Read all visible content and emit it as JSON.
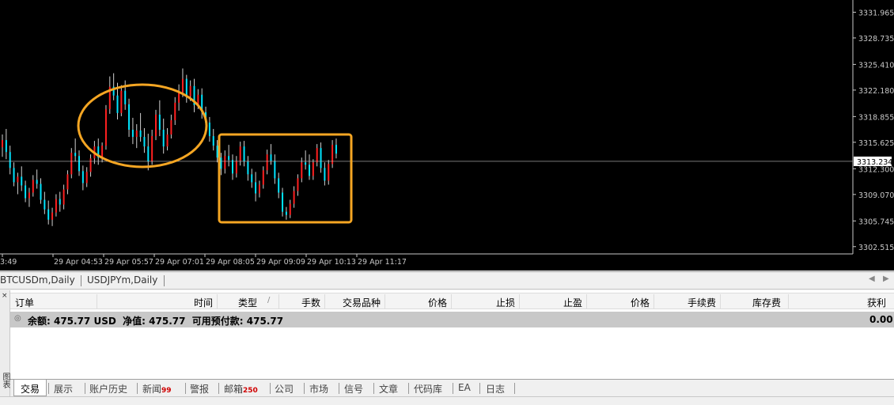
{
  "chart": {
    "background": "#000000",
    "bull_color": "#ff2020",
    "bear_color": "#00e5ff",
    "wick_color": "#d0d0d0",
    "annotation_color": "#f5a623",
    "bid_line_color": "#c0c0c0",
    "price_axis_labels": [
      "3331.965",
      "3328.735",
      "3325.410",
      "3322.180",
      "3318.855",
      "3315.625",
      "3312.300",
      "3309.070",
      "3305.745",
      "3302.515"
    ],
    "current_price": "3313.234",
    "time_axis_labels": [
      "3:49",
      "29 Apr 04:53",
      "29 Apr 05:57",
      "29 Apr 07:01",
      "29 Apr 08:05",
      "29 Apr 09:09",
      "29 Apr 10:13",
      "29 Apr 11:17"
    ]
  },
  "chart_data": {
    "type": "candlestick",
    "ylim": [
      3301.6,
      3333.5
    ],
    "annotations": [
      {
        "shape": "ellipse",
        "label": ""
      },
      {
        "shape": "rectangle",
        "label": ""
      }
    ],
    "candles": [
      [
        3315,
        3316.6,
        3313.8,
        3315.9
      ],
      [
        3315.9,
        3317.3,
        3313.5,
        3314.4
      ],
      [
        3314.4,
        3315.2,
        3311.6,
        3312.4
      ],
      [
        3312.4,
        3313.1,
        3310.1,
        3310.6
      ],
      [
        3310.6,
        3311.8,
        3309.1,
        3311.3
      ],
      [
        3311.3,
        3312.6,
        3309.5,
        3310.2
      ],
      [
        3310.2,
        3310.8,
        3308.1,
        3308.6
      ],
      [
        3308.6,
        3309.9,
        3307.5,
        3309.3
      ],
      [
        3309.3,
        3311.5,
        3308.8,
        3310.9
      ],
      [
        3310.9,
        3312.2,
        3309.8,
        3310.4
      ],
      [
        3310.4,
        3311.1,
        3307.9,
        3308.4
      ],
      [
        3308.4,
        3309.4,
        3306.6,
        3307.2
      ],
      [
        3307.2,
        3308.3,
        3305.3,
        3305.9
      ],
      [
        3305.9,
        3307.4,
        3305.1,
        3306.8
      ],
      [
        3306.8,
        3309.1,
        3306.3,
        3308.5
      ],
      [
        3308.5,
        3309.4,
        3306.9,
        3307.8
      ],
      [
        3307.8,
        3310.3,
        3307.2,
        3309.7
      ],
      [
        3309.7,
        3312.1,
        3309.1,
        3311.6
      ],
      [
        3311.6,
        3314.9,
        3311.1,
        3314.3
      ],
      [
        3314.3,
        3316.1,
        3313.2,
        3313.9
      ],
      [
        3313.9,
        3314.6,
        3311.4,
        3312.0
      ],
      [
        3312.0,
        3312.7,
        3309.6,
        3310.5
      ],
      [
        3310.5,
        3312.5,
        3310.0,
        3311.9
      ],
      [
        3311.9,
        3314.1,
        3311.3,
        3313.6
      ],
      [
        3313.6,
        3315.8,
        3312.9,
        3315.1
      ],
      [
        3315.1,
        3316.1,
        3312.8,
        3313.7
      ],
      [
        3313.7,
        3315.6,
        3313.1,
        3315.2
      ],
      [
        3315.2,
        3320.3,
        3314.7,
        3319.8
      ],
      [
        3319.8,
        3323.9,
        3319.2,
        3322.6
      ],
      [
        3322.6,
        3324.3,
        3320.9,
        3321.5
      ],
      [
        3321.5,
        3323.1,
        3318.5,
        3319.3
      ],
      [
        3319.3,
        3322.8,
        3318.9,
        3322.1
      ],
      [
        3322.1,
        3323.4,
        3319.7,
        3320.4
      ],
      [
        3320.4,
        3321.1,
        3316.3,
        3317.2
      ],
      [
        3317.2,
        3318.7,
        3315.4,
        3316.3
      ],
      [
        3316.3,
        3317.9,
        3314.9,
        3317.1
      ],
      [
        3317.1,
        3319.3,
        3315.7,
        3316.3
      ],
      [
        3316.3,
        3317.4,
        3314.3,
        3315.1
      ],
      [
        3315.1,
        3316.7,
        3312.1,
        3313.2
      ],
      [
        3313.2,
        3317.2,
        3312.8,
        3316.4
      ],
      [
        3316.4,
        3319.7,
        3315.9,
        3319.1
      ],
      [
        3319.1,
        3320.9,
        3316.4,
        3317.2
      ],
      [
        3317.2,
        3318.6,
        3314.2,
        3315.1
      ],
      [
        3315.1,
        3317.4,
        3314.6,
        3316.6
      ],
      [
        3316.6,
        3319.1,
        3316.1,
        3318.4
      ],
      [
        3318.4,
        3321.3,
        3317.8,
        3320.6
      ],
      [
        3320.6,
        3322.9,
        3319.6,
        3321.9
      ],
      [
        3321.9,
        3324.9,
        3321.3,
        3323.6
      ],
      [
        3323.6,
        3324.1,
        3320.6,
        3321.4
      ],
      [
        3321.4,
        3323.4,
        3320.8,
        3322.7
      ],
      [
        3322.7,
        3323.6,
        3319.4,
        3320.3
      ],
      [
        3320.3,
        3322.3,
        3319.8,
        3321.6
      ],
      [
        3321.6,
        3322.4,
        3318.6,
        3319.4
      ],
      [
        3319.4,
        3320.1,
        3316.9,
        3318.1
      ],
      [
        3318.1,
        3318.8,
        3315.7,
        3316.4
      ],
      [
        3316.4,
        3317.3,
        3314.6,
        3315.2
      ],
      [
        3315.2,
        3315.9,
        3313.1,
        3313.7
      ],
      [
        3313.7,
        3314.3,
        3311.5,
        3312.3
      ],
      [
        3312.3,
        3314.6,
        3311.7,
        3313.9
      ],
      [
        3313.9,
        3315.3,
        3312.6,
        3313.4
      ],
      [
        3313.4,
        3314.1,
        3310.9,
        3311.7
      ],
      [
        3311.7,
        3313.9,
        3311.2,
        3313.3
      ],
      [
        3313.3,
        3315.7,
        3312.7,
        3315.1
      ],
      [
        3315.1,
        3315.8,
        3312.6,
        3313.2
      ],
      [
        3313.2,
        3313.9,
        3310.8,
        3311.6
      ],
      [
        3311.6,
        3312.3,
        3309.9,
        3310.6
      ],
      [
        3310.6,
        3311.9,
        3308.2,
        3309.2
      ],
      [
        3309.2,
        3310.8,
        3308.7,
        3310.3
      ],
      [
        3310.3,
        3312.6,
        3309.8,
        3312.1
      ],
      [
        3312.1,
        3314.7,
        3311.6,
        3314.1
      ],
      [
        3314.1,
        3315.4,
        3312.8,
        3313.3
      ],
      [
        3313.3,
        3314.1,
        3310.4,
        3311.1
      ],
      [
        3311.1,
        3311.8,
        3308.6,
        3309.3
      ],
      [
        3309.3,
        3309.9,
        3306.3,
        3306.9
      ],
      [
        3306.9,
        3307.5,
        3305.9,
        3306.5
      ],
      [
        3306.5,
        3308.4,
        3306.1,
        3307.9
      ],
      [
        3307.9,
        3310.1,
        3307.4,
        3309.5
      ],
      [
        3309.5,
        3311.6,
        3308.9,
        3311.1
      ],
      [
        3311.1,
        3313.7,
        3310.6,
        3313.1
      ],
      [
        3313.1,
        3314.6,
        3312.2,
        3312.8
      ],
      [
        3312.8,
        3314.1,
        3310.9,
        3311.4
      ],
      [
        3311.4,
        3313.5,
        3310.9,
        3313.1
      ],
      [
        3313.1,
        3315.4,
        3312.6,
        3314.9
      ],
      [
        3314.9,
        3315.6,
        3311.8,
        3312.4
      ],
      [
        3312.4,
        3313.1,
        3310.2,
        3310.8
      ],
      [
        3310.8,
        3313.4,
        3310.3,
        3312.9
      ],
      [
        3312.9,
        3315.9,
        3312.4,
        3315.3
      ],
      [
        3315.3,
        3316.1,
        3313.6,
        3314.2
      ]
    ]
  },
  "symbol_tabs": [
    "BTCUSDm,Daily",
    "USDJPYm,Daily"
  ],
  "terminal": {
    "side_label": "图表",
    "close_glyph": "×",
    "columns": [
      "订单",
      "时间",
      "类型",
      "手数",
      "交易品种",
      "价格",
      "止损",
      "止盈",
      "价格",
      "手续费",
      "库存费",
      "获利"
    ],
    "sort_indicator": "/",
    "balance_line": "余额: 475.77 USD  净值: 475.77  可用预付款: 475.77",
    "balance_profit": "0.00",
    "tabs": [
      {
        "label": "交易",
        "badge": ""
      },
      {
        "label": "展示",
        "badge": ""
      },
      {
        "label": "账户历史",
        "badge": ""
      },
      {
        "label": "新闻",
        "badge": "99"
      },
      {
        "label": "警报",
        "badge": ""
      },
      {
        "label": "邮箱",
        "badge": "250"
      },
      {
        "label": "公司",
        "badge": ""
      },
      {
        "label": "市场",
        "badge": ""
      },
      {
        "label": "信号",
        "badge": ""
      },
      {
        "label": "文章",
        "badge": ""
      },
      {
        "label": "代码库",
        "badge": ""
      },
      {
        "label": "EA",
        "badge": ""
      },
      {
        "label": "日志",
        "badge": ""
      }
    ]
  }
}
